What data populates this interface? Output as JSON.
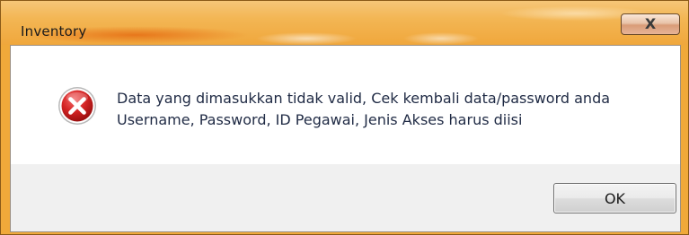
{
  "window": {
    "title": "Inventory",
    "close_label": "X"
  },
  "message": {
    "line1": "Data yang dimasukkan tidak valid, Cek kembali data/password anda",
    "line2": "Username, Password, ID Pegawai, Jenis Akses harus diisi",
    "icon": "error-icon"
  },
  "buttons": {
    "ok_label": "OK"
  },
  "colors": {
    "titlebar": "#f0a93a",
    "error_red": "#c81e1e",
    "content_bg": "#f0f0f0"
  }
}
